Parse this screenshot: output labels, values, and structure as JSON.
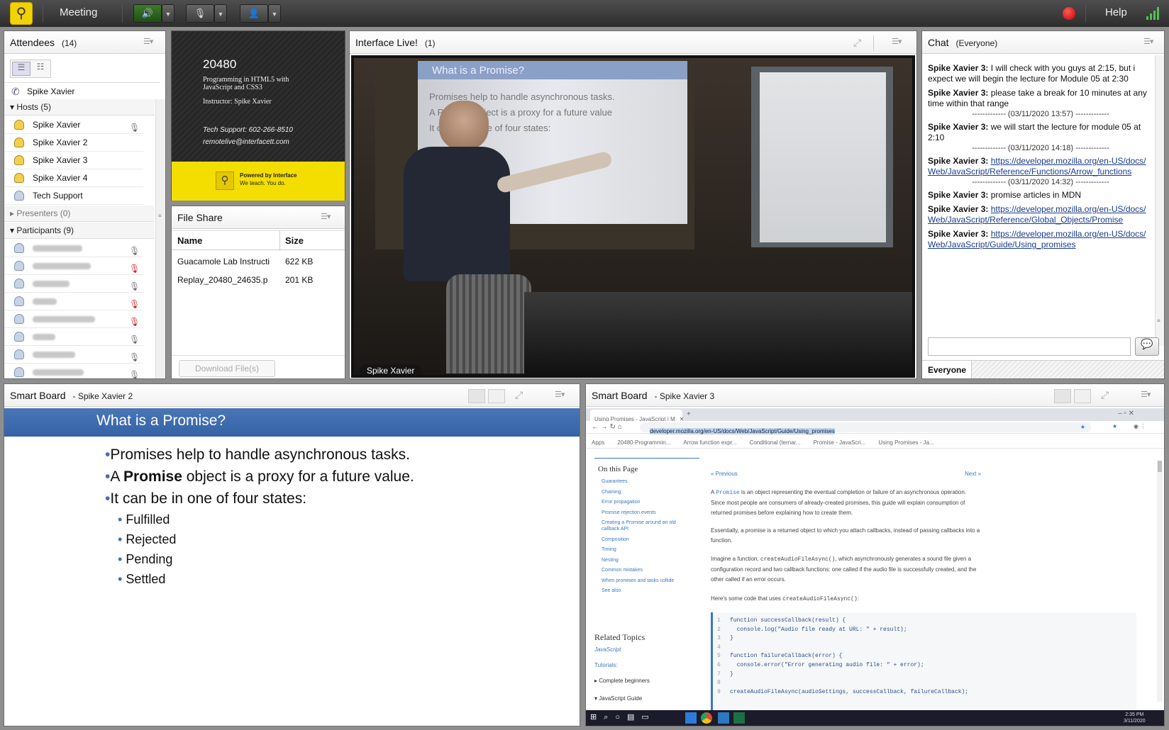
{
  "topbar": {
    "meeting_label": "Meeting",
    "help_label": "Help",
    "speaker_icon": "speaker-icon",
    "mic_icon": "microphone-icon",
    "camera_icon": "webcam-icon"
  },
  "attendees": {
    "title": "Attendees",
    "count": "(14)",
    "me": "Spike Xavier",
    "hosts_label": "Hosts (5)",
    "hosts": [
      "Spike Xavier",
      "Spike Xavier 2",
      "Spike Xavier 3",
      "Spike Xavier 4",
      "Tech Support"
    ],
    "presenters_label": "Presenters (0)",
    "participants_label": "Participants (9)"
  },
  "course": {
    "number": "20480",
    "title": "Programming in HTML5 with JavaScript and CSS3",
    "instructor": "Instructor: Spike Xavier",
    "support": "Tech Support: 602-266-8510",
    "email": "remotelive@interfacett.com",
    "powered_line1": "Powered by Interface",
    "powered_line2": "We teach. You do."
  },
  "fileshare": {
    "title": "File Share",
    "col_name": "Name",
    "col_size": "Size",
    "files": [
      {
        "name": "Guacamole Lab Instructi",
        "size": "622 KB"
      },
      {
        "name": "Replay_20480_24635.p",
        "size": "201 KB"
      }
    ],
    "download_label": "Download File(s)"
  },
  "video": {
    "title": "Interface Live!",
    "count": "(1)",
    "presenter": "Spike Xavier",
    "slide_title": "What is a Promise?",
    "slide_bullets": [
      "Promises help to handle asynchronous tasks.",
      "A Promise object is a proxy for a future value",
      "It can be in one of four states:"
    ]
  },
  "chat": {
    "title": "Chat",
    "scope": "(Everyone)",
    "everyone_tab": "Everyone",
    "messages": [
      {
        "sender": "Spike Xavier 3:",
        "text": "I will check with you guys at 2:15, but i expect we will begin the lecture for Module 05 at 2:30"
      },
      {
        "sender": "Spike Xavier 3:",
        "text": "please take a break for 10 minutes at any time within that range"
      },
      {
        "sep": "------------- (03/11/2020 13:57) -------------"
      },
      {
        "sender": "Spike Xavier 3:",
        "text": "we will start the lecture for module 05 at 2:10"
      },
      {
        "sep": "------------- (03/11/2020 14:18) -------------"
      },
      {
        "sender": "Spike Xavier 3:",
        "link": "https://developer.mozilla.org/en-US/docs/Web/JavaScript/Reference/Functions/Arrow_functions"
      },
      {
        "sep": "------------- (03/11/2020 14:32) -------------"
      },
      {
        "sender": "Spike Xavier 3:",
        "text": "promise articles in MDN"
      },
      {
        "sender": "Spike Xavier 3:",
        "link": "https://developer.mozilla.org/en-US/docs/Web/JavaScript/Reference/Global_Objects/Promise"
      },
      {
        "sender": "Spike Xavier 3:",
        "link": "https://developer.mozilla.org/en-US/docs/Web/JavaScript/Guide/Using_promises"
      }
    ]
  },
  "smartboard1": {
    "title": "Smart Board",
    "owner": "- Spike Xavier 2",
    "slide_title": "What is a Promise?",
    "b1": "Promises help to handle asynchronous tasks.",
    "b2_pre": "A ",
    "b2_bold": "Promise",
    "b2_post": " object is a proxy for a future value.",
    "b3": "It can be in one of four states:",
    "states": [
      "Fulfilled",
      "Rejected",
      "Pending",
      "Settled"
    ]
  },
  "smartboard2": {
    "title": "Smart Board",
    "owner": "- Spike Xavier 3",
    "tab_title": "Using Promises - JavaScript | M",
    "url": "developer.mozilla.org/en-US/docs/Web/JavaScript/Guide/Using_promises",
    "bookmarks": [
      "Apps",
      "20480-Programmin...",
      "Arrow function expr...",
      "Conditional (ternar...",
      "Promise - JavaScri...",
      "Using Promises - Ja..."
    ],
    "on_this_page": "On this Page",
    "toc": [
      "Guarantees",
      "Chaining",
      "Error propagation",
      "Promise rejection events",
      "Creating a Promise around an old callback API",
      "Composition",
      "Timing",
      "Nesting",
      "Common mistakes",
      "When promises and tasks collide",
      "See also"
    ],
    "related": "Related Topics",
    "related_js": "JavaScript",
    "tutorials": "Tutorials:",
    "complete_beginners": "Complete beginners",
    "js_guide": "JavaScript Guide",
    "prev": "« Previous",
    "next": "Next »",
    "p1_pre": "A ",
    "p1_code": "Promise",
    "p1_text": " is an object representing the eventual completion or failure of an asynchronous operation. Since most people are consumers of already-created promises, this guide will explain consumption of returned promises before explaining how to create them.",
    "p2": "Essentially, a promise is a returned object to which you attach callbacks, instead of passing callbacks into a function.",
    "p3_pre": "Imagine a function, ",
    "p3_code": "createAudioFileAsync()",
    "p3_text": ", which asynchronously generates a sound file given a configuration record and two callback functions: one called if the audio file is successfully created, and the other called if an error occurs.",
    "p4_pre": "Here's some code that uses ",
    "p4_code": "createAudioFileAsync()",
    "p4_post": ":",
    "code_lines": [
      "function successCallback(result) {",
      "  console.log(\"Audio file ready at URL: \" + result);",
      "}",
      "",
      "function failureCallback(error) {",
      "  console.error(\"Error generating audio file: \" + error);",
      "}",
      "",
      "createAudioFileAsync(audioSettings, successCallback, failureCallback);"
    ],
    "clock_time": "2:35 PM",
    "clock_date": "3/11/2020"
  }
}
